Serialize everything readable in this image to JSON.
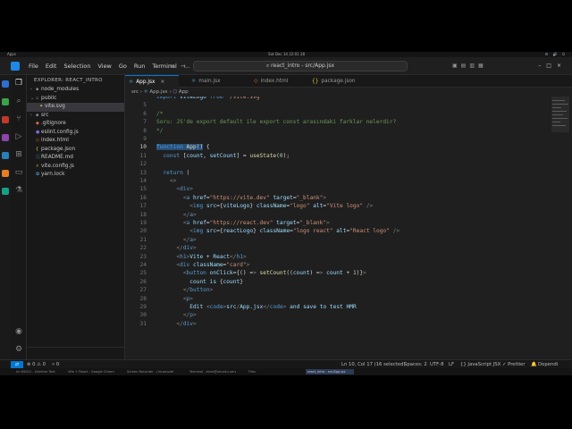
{
  "topbar": {
    "activities": "Apps",
    "clock": "Sat Dec 14  22:01 28",
    "tray": "⚙ 🔊 ⏻"
  },
  "titlebar": {
    "menu": [
      "File",
      "Edit",
      "Selection",
      "View",
      "Go",
      "Run",
      "Terminal"
    ],
    "more": "…",
    "search_value": "react_intro - src/App.jsx"
  },
  "sidebar": {
    "title": "EXPLORER: REACT_INTRO",
    "items": [
      {
        "label": "node_modules",
        "type": "folder-closed"
      },
      {
        "label": "public",
        "type": "folder-open"
      },
      {
        "label": "vite.svg",
        "type": "svg"
      },
      {
        "label": "src",
        "type": "folder-closed"
      },
      {
        "label": ".gitignore",
        "type": "git"
      },
      {
        "label": "eslint.config.js",
        "type": "js"
      },
      {
        "label": "index.html",
        "type": "html"
      },
      {
        "label": "package.json",
        "type": "json"
      },
      {
        "label": "README.md",
        "type": "md"
      },
      {
        "label": "vite.config.js",
        "type": "js"
      },
      {
        "label": "yarn.lock",
        "type": "yarn"
      }
    ]
  },
  "tabs": [
    {
      "label": "App.jsx",
      "close": "×"
    },
    {
      "label": "main.jsx"
    },
    {
      "label": "index.html"
    },
    {
      "label": "package.json"
    }
  ],
  "breadcrumb": {
    "folder": "src",
    "file": "App.jsx",
    "symbol": "App"
  },
  "editor": {
    "lines": [
      {
        "n": "",
        "text": "import viteLogo from '/vite.svg'"
      },
      {
        "n": "5",
        "text": ""
      },
      {
        "n": "6",
        "text": "/*"
      },
      {
        "n": "7",
        "text": "Soru: JS'de export default ile export const arasındaki farklar nelerdir?"
      },
      {
        "n": "8",
        "text": "*/"
      },
      {
        "n": "9",
        "text": ""
      },
      {
        "n": "10",
        "text": "function App() {"
      },
      {
        "n": "11",
        "text": "  const [count, setCount] = useState(0);"
      },
      {
        "n": "12",
        "text": ""
      },
      {
        "n": "13",
        "text": "  return ("
      },
      {
        "n": "14",
        "text": "    <>"
      },
      {
        "n": "15",
        "text": "      <div>"
      },
      {
        "n": "16",
        "text": "        <a href=\"https://vite.dev\" target=\"_blank\">"
      },
      {
        "n": "17",
        "text": "          <img src={viteLogo} className=\"logo\" alt=\"Vite logo\" />"
      },
      {
        "n": "18",
        "text": "        </a>"
      },
      {
        "n": "19",
        "text": "        <a href=\"https://react.dev\" target=\"_blank\">"
      },
      {
        "n": "20",
        "text": "          <img src={reactLogo} className=\"logo react\" alt=\"React logo\" />"
      },
      {
        "n": "21",
        "text": "        </a>"
      },
      {
        "n": "22",
        "text": "      </div>"
      },
      {
        "n": "23",
        "text": "      <h1>Vite + React</h1>"
      },
      {
        "n": "24",
        "text": "      <div className=\"card\">"
      },
      {
        "n": "25",
        "text": "        <button onClick={() => setCount((count) => count + 1)}>"
      },
      {
        "n": "26",
        "text": "          count is {count}"
      },
      {
        "n": "27",
        "text": "        </button>"
      },
      {
        "n": "28",
        "text": "        <p>"
      },
      {
        "n": "29",
        "text": "          Edit <code>src/App.jsx</code> and save to test HMR"
      },
      {
        "n": "30",
        "text": "        </p>"
      },
      {
        "n": "31",
        "text": "      </div>"
      }
    ]
  },
  "statusbar": {
    "remote": "⇄",
    "problems": "⊗ 0 ⚠ 0",
    "ports": "⑂ 0",
    "position": "Ln 10, Col 17 (16 selected)",
    "spaces": "Spaces: 2",
    "encoding": "UTF-8",
    "eol": "LF",
    "language": "{} JavaScript JSX",
    "prettier": "✓ Prettier",
    "extra": "Dependi"
  },
  "taskbar": {
    "tasks": [
      "kri E0021 - Sublime Text",
      "Vite + React - Google Chrome",
      "Screen Recorder - (incomplete)",
      "Terminal - enes@ubuntu-server",
      "Files",
      "react_intro - src/App.jsx"
    ]
  },
  "colors": {
    "accent": "#0078d4",
    "selection": "#264f78",
    "comment": "#6a9955",
    "keyword": "#569cd6",
    "string": "#ce9178",
    "function": "#dcdcaa",
    "variable": "#9cdcfe",
    "tag": "#569cd6",
    "attr": "#9cdcfe"
  }
}
